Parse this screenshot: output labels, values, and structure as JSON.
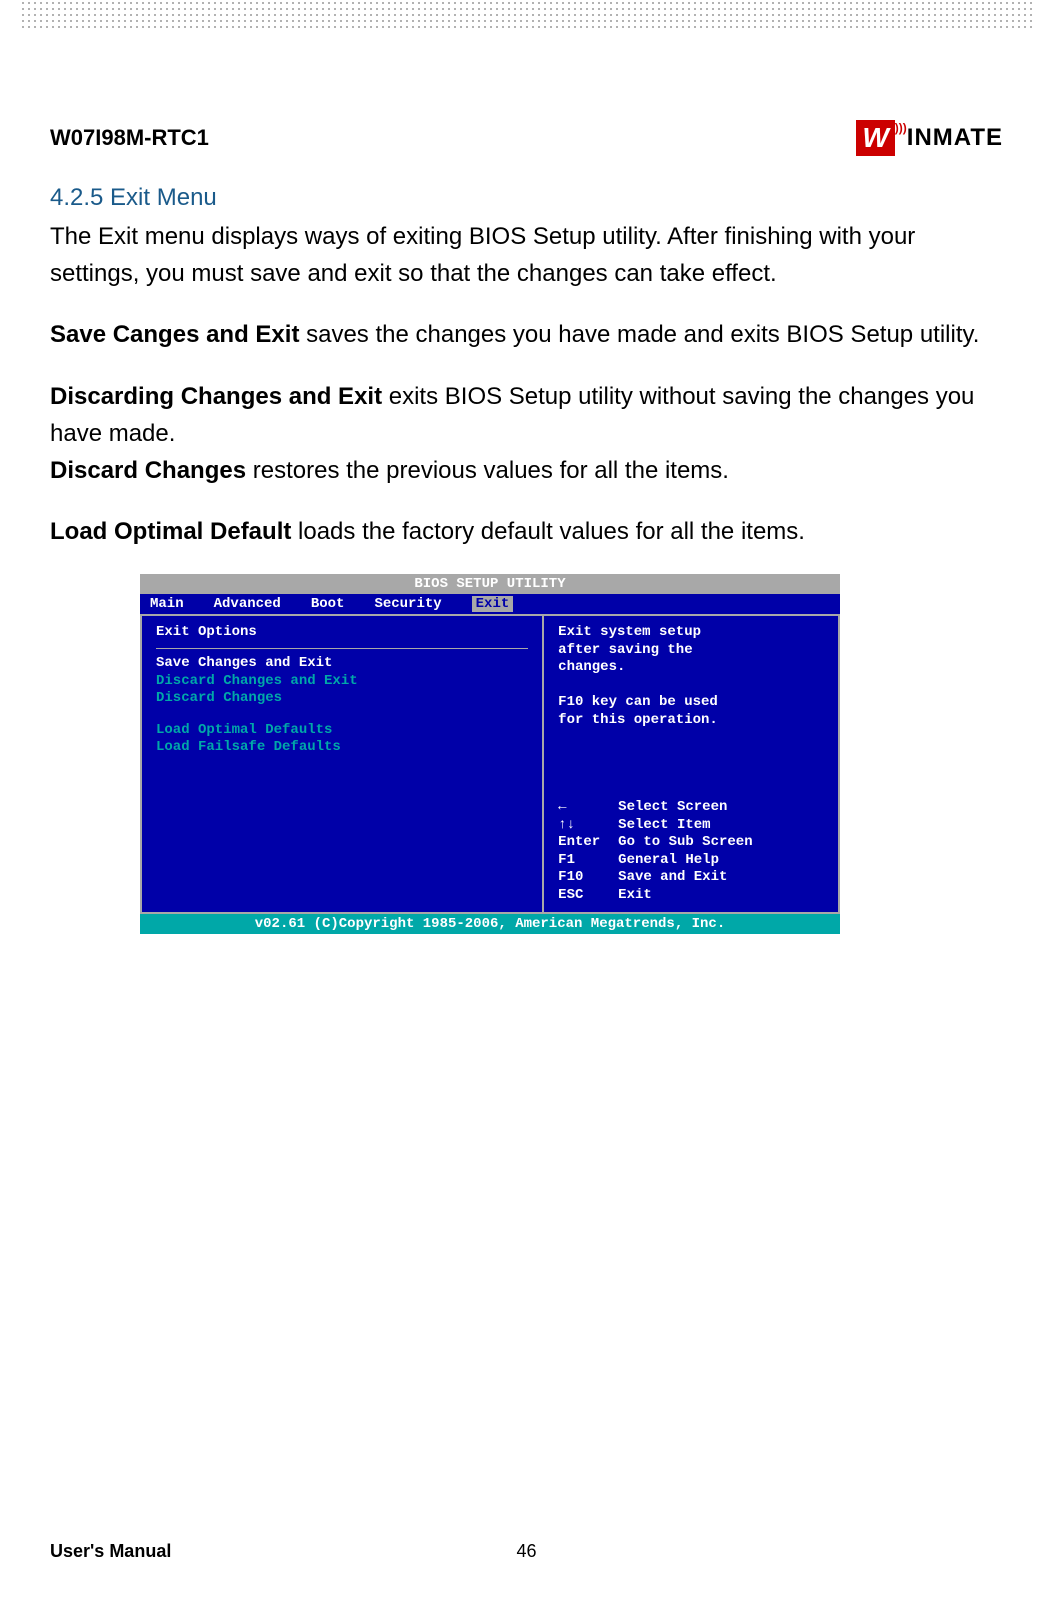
{
  "header": {
    "model": "W07I98M-RTC1",
    "logo_main": "W",
    "logo_rest": "INMATE"
  },
  "section": {
    "heading": "4.2.5 Exit Menu",
    "intro": "The Exit menu displays ways of exiting BIOS Setup utility. After finishing with your settings, you must save and exit so that the changes can take effect.",
    "save_label": "Save Canges and Exit",
    "save_text": " saves the changes you have made and exits BIOS Setup utility.",
    "discard_exit_label": "Discarding Changes and Exit",
    "discard_exit_text": " exits BIOS Setup utility without saving the changes you have made.",
    "discard_label": "Discard Changes",
    "discard_text": " restores the previous values for all the items.",
    "optimal_label": "Load Optimal Default",
    "optimal_text": " loads the factory default values for all the items."
  },
  "bios": {
    "title": "BIOS SETUP UTILITY",
    "menu": [
      "Main",
      "Advanced",
      "Boot",
      "Security",
      "Exit"
    ],
    "menu_active_index": 4,
    "left": {
      "heading": "Exit Options",
      "items_top": [
        "Save Changes and Exit",
        "Discard Changes and Exit",
        "Discard Changes"
      ],
      "items_bottom": [
        "Load Optimal Defaults",
        "Load Failsafe Defaults"
      ],
      "selected_index": 0
    },
    "right": {
      "help": [
        "Exit system setup",
        "after saving the",
        "changes.",
        "",
        "F10 key can be used",
        "for this operation."
      ],
      "nav": [
        {
          "key": "←",
          "text": "Select Screen"
        },
        {
          "key": "↑↓",
          "text": "Select Item"
        },
        {
          "key": "Enter",
          "text": "Go to Sub Screen"
        },
        {
          "key": "F1",
          "text": "General Help"
        },
        {
          "key": "F10",
          "text": "Save and Exit"
        },
        {
          "key": "ESC",
          "text": "Exit"
        }
      ]
    },
    "footer": "v02.61 (C)Copyright 1985-2006, American Megatrends, Inc."
  },
  "footer": {
    "label": "User's Manual",
    "page": "46"
  }
}
